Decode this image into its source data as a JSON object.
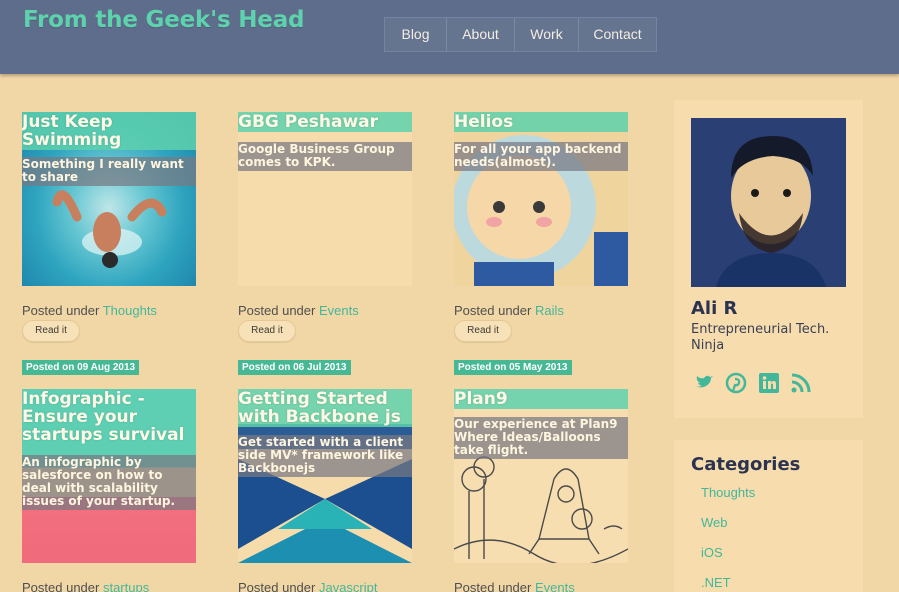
{
  "header": {
    "site_title": "From the Geek's Head",
    "nav": [
      "Blog",
      "About",
      "Work",
      "Contact"
    ]
  },
  "posts": [
    {
      "title": "Just Keep Swimming",
      "desc": "Something I really want to share",
      "posted_prefix": "Posted under",
      "category": "Thoughts",
      "read_label": "Read it"
    },
    {
      "title": "GBG Peshawar",
      "desc": "Google Business Group comes to KPK.",
      "posted_prefix": "Posted under",
      "category": "Events",
      "read_label": "Read it"
    },
    {
      "title": "Helios",
      "desc": "For all your app backend needs(almost).",
      "posted_prefix": "Posted under",
      "category": "Rails",
      "read_label": "Read it"
    },
    {
      "date": "Posted on 09 Aug 2013",
      "title": "Infographic - Ensure your startups survival",
      "desc": "An infographic by salesforce on how to deal with scalability issues of your startup.",
      "posted_prefix": "Posted under",
      "category": "startups"
    },
    {
      "date": "Posted on 06 Jul 2013",
      "title": "Getting Started with Backbone js",
      "desc": "Get started with a client side MV* framework like Backbonejs",
      "posted_prefix": "Posted under",
      "category": "Javascript"
    },
    {
      "date": "Posted on 05 May 2013",
      "title": "Plan9",
      "desc": "Our experience at Plan9 Where Ideas/Balloons take flight.",
      "posted_prefix": "Posted under",
      "category": "Events"
    }
  ],
  "profile": {
    "name": "Ali R",
    "role": "Entrepreneurial Tech. Ninja",
    "social_icons": [
      "twitter-icon",
      "pinterest-icon",
      "linkedin-icon",
      "rss-icon"
    ]
  },
  "categories": {
    "heading": "Categories",
    "items": [
      "Thoughts",
      "Web",
      "iOS",
      ".NET"
    ]
  },
  "colors": {
    "background": "#f2d7a6",
    "header": "#5e6d8c",
    "accent": "#43b79a",
    "title_green": "#5ed1ad"
  }
}
